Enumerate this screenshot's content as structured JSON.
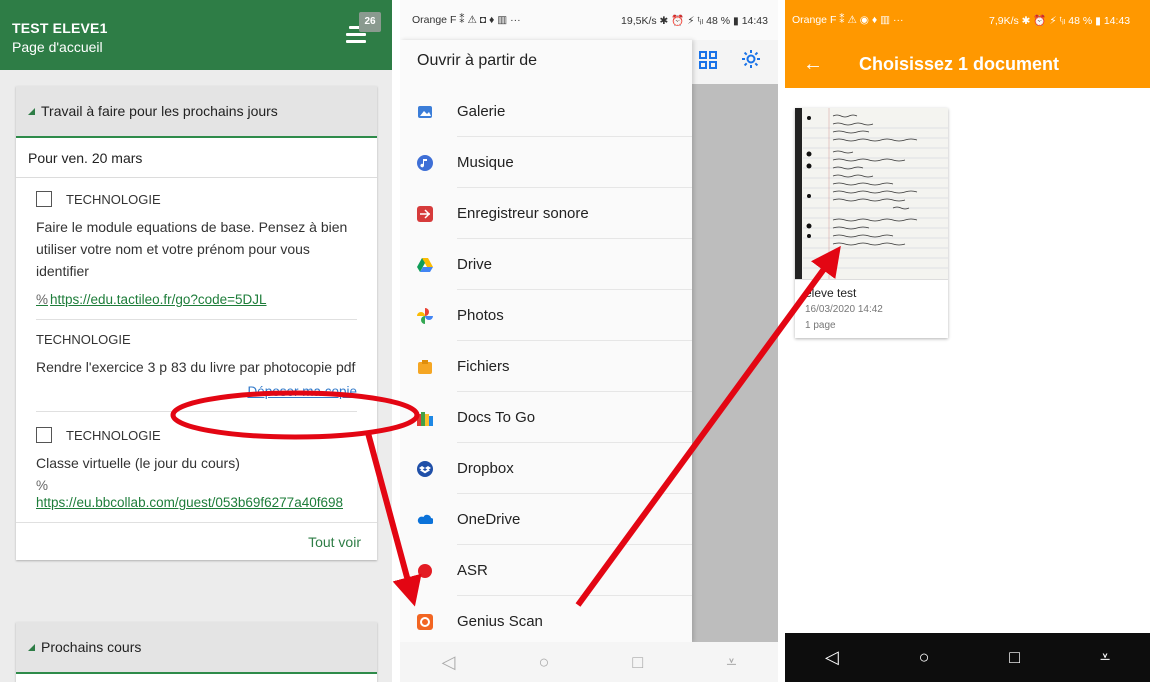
{
  "left": {
    "user": "TEST ELEVE1",
    "page": "Page d'accueil",
    "notif_count": "26",
    "section1_title": "Travail à faire pour les prochains jours",
    "date": "Pour ven. 20 mars",
    "tasks": [
      {
        "subject": "TECHNOLOGIE",
        "desc": "Faire le module equations de base. Pensez à bien utiliser votre nom et votre prénom pour vous identifier",
        "link": "https://edu.tactileo.fr/go?code=5DJL"
      },
      {
        "subject": "TECHNOLOGIE",
        "desc": "Rendre l'exercice 3 p 83 du livre par photocopie pdf",
        "action": "Déposer ma copie"
      },
      {
        "subject": "TECHNOLOGIE",
        "desc": "Classe virtuelle (le jour du cours)",
        "link": "https://eu.bbcollab.com/guest/053b69f6277a40f698"
      }
    ],
    "see_all": "Tout voir",
    "section2_title": "Prochains cours"
  },
  "middle": {
    "status_left": "Orange F ⁑ ⚠ ◘ ♦ ▥ ···",
    "status_right": "19,5K/s ✱ ⏰ ⚡ ᵗᵢₗ 48 % ▮ 14:43",
    "drawer_title": "Ouvrir à partir de",
    "items": [
      "Galerie",
      "Musique",
      "Enregistreur sonore",
      "Drive",
      "Photos",
      "Fichiers",
      "Docs To Go",
      "Dropbox",
      "OneDrive",
      "ASR",
      "Genius Scan"
    ]
  },
  "right": {
    "status_left": "Orange F ⁑ ⚠ ◉ ♦ ▥ ···",
    "status_right": "7,9K/s ✱ ⏰ ⚡ ᵗᵢₗ 48 % ▮ 14:43",
    "title": "Choisissez 1 document",
    "doc_name": "eleve test",
    "doc_date": "16/03/2020 14:42",
    "doc_pages": "1 page"
  },
  "colors": {
    "pronote_green": "#2e7d46",
    "scan_orange": "#ff9800",
    "annotation_red": "#e30613",
    "link_blue": "#2f78c9"
  },
  "icons": {
    "back": "arrow-left-icon",
    "menu": "hamburger-menu-icon",
    "grid": "grid-view-icon",
    "settings": "gear-icon"
  }
}
